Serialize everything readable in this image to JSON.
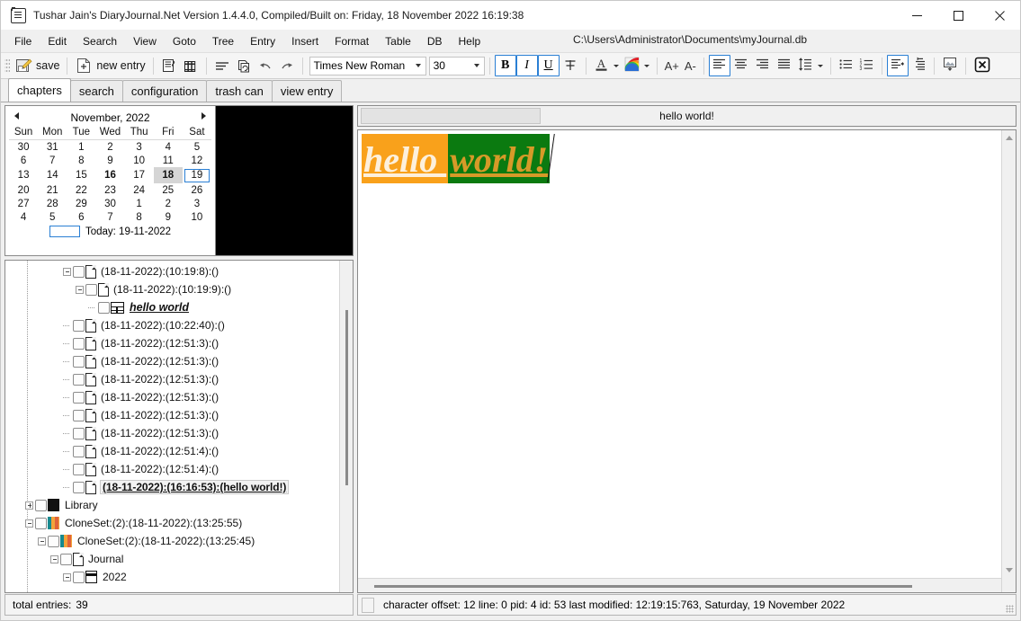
{
  "window": {
    "title": "Tushar Jain's DiaryJournal.Net Version 1.4.4.0, Compiled/Built on: Friday, 18 November 2022 16:19:38",
    "app_icon": "journal-icon",
    "minimize": "minimize-icon",
    "maximize": "maximize-icon",
    "close": "close-icon"
  },
  "menubar": {
    "items": [
      "File",
      "Edit",
      "Search",
      "View",
      "Goto",
      "Tree",
      "Entry",
      "Insert",
      "Format",
      "Table",
      "DB",
      "Help"
    ],
    "db_path": "C:\\Users\\Administrator\\Documents\\myJournal.db"
  },
  "toolbar": {
    "save_label": "save",
    "new_entry_label": "new entry",
    "font_family_value": "Times New Roman",
    "font_size_value": "30",
    "bold_label": "B",
    "italic_label": "I",
    "underline_label": "U",
    "strikethrough_label": "S",
    "font_color_label": "A",
    "grow_font_label": "A+",
    "shrink_font_label": "A-",
    "bold_active": true,
    "italic_active": true,
    "underline_active": true,
    "align_left_active": true,
    "indent_active": true,
    "accent_color": "#2a7fd4"
  },
  "tabs": {
    "items": [
      {
        "label": "chapters",
        "active": true
      },
      {
        "label": "search",
        "active": false
      },
      {
        "label": "configuration",
        "active": false
      },
      {
        "label": "trash can",
        "active": false
      },
      {
        "label": "view entry",
        "active": false
      }
    ]
  },
  "calendar": {
    "month_label": "November, 2022",
    "prev_label": "◄",
    "next_label": "►",
    "weekdays": [
      "Sun",
      "Mon",
      "Tue",
      "Wed",
      "Thu",
      "Fri",
      "Sat"
    ],
    "weeks": [
      [
        {
          "d": "30",
          "t": "out"
        },
        {
          "d": "31",
          "t": "out"
        },
        {
          "d": "1",
          "t": ""
        },
        {
          "d": "2",
          "t": ""
        },
        {
          "d": "3",
          "t": ""
        },
        {
          "d": "4",
          "t": ""
        },
        {
          "d": "5",
          "t": ""
        }
      ],
      [
        {
          "d": "6",
          "t": ""
        },
        {
          "d": "7",
          "t": ""
        },
        {
          "d": "8",
          "t": ""
        },
        {
          "d": "9",
          "t": ""
        },
        {
          "d": "10",
          "t": ""
        },
        {
          "d": "11",
          "t": ""
        },
        {
          "d": "12",
          "t": ""
        }
      ],
      [
        {
          "d": "13",
          "t": ""
        },
        {
          "d": "14",
          "t": ""
        },
        {
          "d": "15",
          "t": ""
        },
        {
          "d": "16",
          "t": "bold"
        },
        {
          "d": "17",
          "t": ""
        },
        {
          "d": "18",
          "t": "sel"
        },
        {
          "d": "19",
          "t": "today-ring"
        }
      ],
      [
        {
          "d": "20",
          "t": ""
        },
        {
          "d": "21",
          "t": ""
        },
        {
          "d": "22",
          "t": ""
        },
        {
          "d": "23",
          "t": ""
        },
        {
          "d": "24",
          "t": ""
        },
        {
          "d": "25",
          "t": ""
        },
        {
          "d": "26",
          "t": ""
        }
      ],
      [
        {
          "d": "27",
          "t": ""
        },
        {
          "d": "28",
          "t": ""
        },
        {
          "d": "29",
          "t": ""
        },
        {
          "d": "30",
          "t": ""
        },
        {
          "d": "1",
          "t": "out"
        },
        {
          "d": "2",
          "t": "out"
        },
        {
          "d": "3",
          "t": "out"
        }
      ],
      [
        {
          "d": "4",
          "t": "out"
        },
        {
          "d": "5",
          "t": "out"
        },
        {
          "d": "6",
          "t": "out"
        },
        {
          "d": "7",
          "t": "out"
        },
        {
          "d": "8",
          "t": "out"
        },
        {
          "d": "9",
          "t": "out"
        },
        {
          "d": "10",
          "t": "out"
        }
      ]
    ],
    "today_label": "Today: 19-11-2022"
  },
  "tree": {
    "rows": [
      {
        "indent": 4,
        "expander": "minus",
        "icon": "document-icon",
        "label": "(18-11-2022):(10:19:8):()",
        "style": "normal"
      },
      {
        "indent": 5,
        "expander": "minus",
        "icon": "document-icon",
        "label": "(18-11-2022):(10:19:9):()",
        "style": "normal"
      },
      {
        "indent": 6,
        "expander": "none",
        "icon": "table-icon",
        "label": "hello world",
        "style": "hello"
      },
      {
        "indent": 4,
        "expander": "none",
        "icon": "document-icon",
        "label": "(18-11-2022):(10:22:40):()",
        "style": "normal"
      },
      {
        "indent": 4,
        "expander": "none",
        "icon": "document-icon",
        "label": "(18-11-2022):(12:51:3):()",
        "style": "normal"
      },
      {
        "indent": 4,
        "expander": "none",
        "icon": "document-icon",
        "label": "(18-11-2022):(12:51:3):()",
        "style": "normal"
      },
      {
        "indent": 4,
        "expander": "none",
        "icon": "document-icon",
        "label": "(18-11-2022):(12:51:3):()",
        "style": "normal"
      },
      {
        "indent": 4,
        "expander": "none",
        "icon": "document-icon",
        "label": "(18-11-2022):(12:51:3):()",
        "style": "normal"
      },
      {
        "indent": 4,
        "expander": "none",
        "icon": "document-icon",
        "label": "(18-11-2022):(12:51:3):()",
        "style": "normal"
      },
      {
        "indent": 4,
        "expander": "none",
        "icon": "document-icon",
        "label": "(18-11-2022):(12:51:3):()",
        "style": "normal"
      },
      {
        "indent": 4,
        "expander": "none",
        "icon": "document-icon",
        "label": "(18-11-2022):(12:51:4):()",
        "style": "normal"
      },
      {
        "indent": 4,
        "expander": "none",
        "icon": "document-icon",
        "label": "(18-11-2022):(12:51:4):()",
        "style": "normal"
      },
      {
        "indent": 4,
        "expander": "none",
        "icon": "document-icon",
        "label": "(18-11-2022):(16:16:53):(hello world!)",
        "style": "selected"
      },
      {
        "indent": 1,
        "expander": "plus",
        "icon": "book-icon",
        "label": "Library",
        "style": "normal"
      },
      {
        "indent": 1,
        "expander": "minus",
        "icon": "cloneset-icon",
        "label": "CloneSet:(2):(18-11-2022):(13:25:55)",
        "style": "normal"
      },
      {
        "indent": 2,
        "expander": "minus",
        "icon": "cloneset-icon",
        "label": "CloneSet:(2):(18-11-2022):(13:25:45)",
        "style": "normal"
      },
      {
        "indent": 3,
        "expander": "minus",
        "icon": "document-icon",
        "label": "Journal",
        "style": "normal"
      },
      {
        "indent": 4,
        "expander": "minus",
        "icon": "calendar-icon",
        "label": "2022",
        "style": "normal"
      }
    ]
  },
  "entry": {
    "title": "hello world!",
    "search_field_value": "",
    "body_segments": [
      {
        "text": "hello ",
        "bg": "#f9a11b",
        "fg": "#fdf0dc"
      },
      {
        "text": "world!",
        "bg": "#0b7a10",
        "fg": "#d69a28"
      }
    ]
  },
  "status": {
    "total_entries_label": "total entries:",
    "total_entries_value": "39",
    "detail": "character offset:  12  line:  0  pid:  4  id:  53  last modified:  12:19:15:763, Saturday, 19 November 2022"
  }
}
